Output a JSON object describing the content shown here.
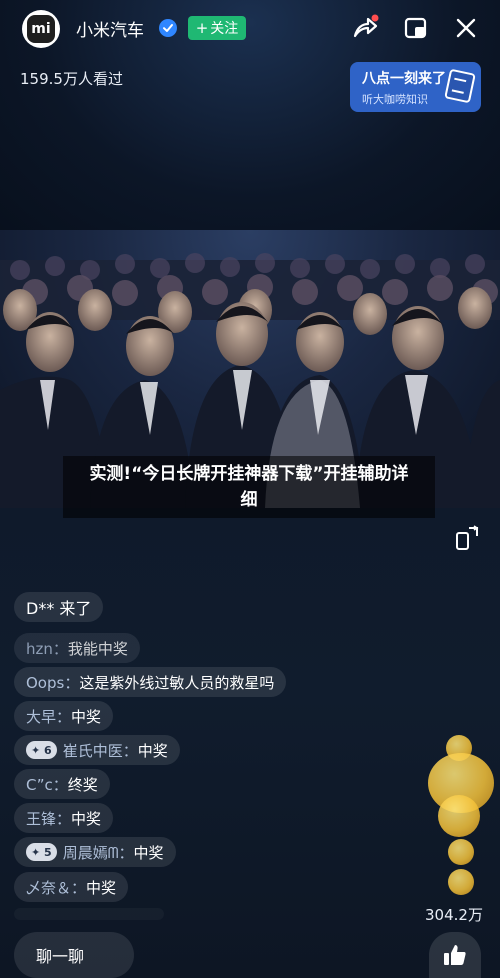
{
  "header": {
    "avatar_text": "mi",
    "channel_name": "小米汽车",
    "follow_label": "关注",
    "viewers": "159.5万人看过"
  },
  "banner": {
    "line1": "八点一刻来了",
    "line2": "听大咖唠知识"
  },
  "video": {
    "caption": "实测!“今日长牌开挂神器下载”开挂辅助详细"
  },
  "chat": {
    "messages": [
      {
        "user": "D** 来了",
        "text": ""
      },
      {
        "user": "hzn：",
        "text": "我能中奖"
      },
      {
        "user": "Oops：",
        "text": "这是紫外线过敏人员的救星吗"
      },
      {
        "user": "大早：",
        "text": "中奖"
      },
      {
        "badge": "6",
        "user": "崔氏中医：",
        "text": "中奖"
      },
      {
        "user": "C”c：",
        "text": "终奖"
      },
      {
        "user": "王锋：",
        "text": "中奖"
      },
      {
        "badge": "5",
        "user": "周晨嫣ᗰ：",
        "text": "中奖"
      },
      {
        "user": "乄奈＆：",
        "text": "中奖"
      }
    ]
  },
  "likes": {
    "count": "304.2万"
  },
  "bottom": {
    "input_label": "聊一聊"
  },
  "colors": {
    "follow_green": "#1fb873",
    "verified_blue": "#2f86ff",
    "banner_blue": "#2f63c7"
  },
  "icons": [
    "share-icon",
    "float-window-icon",
    "close-icon",
    "rotate-screen-icon",
    "thumbs-up-icon",
    "verified-icon"
  ]
}
